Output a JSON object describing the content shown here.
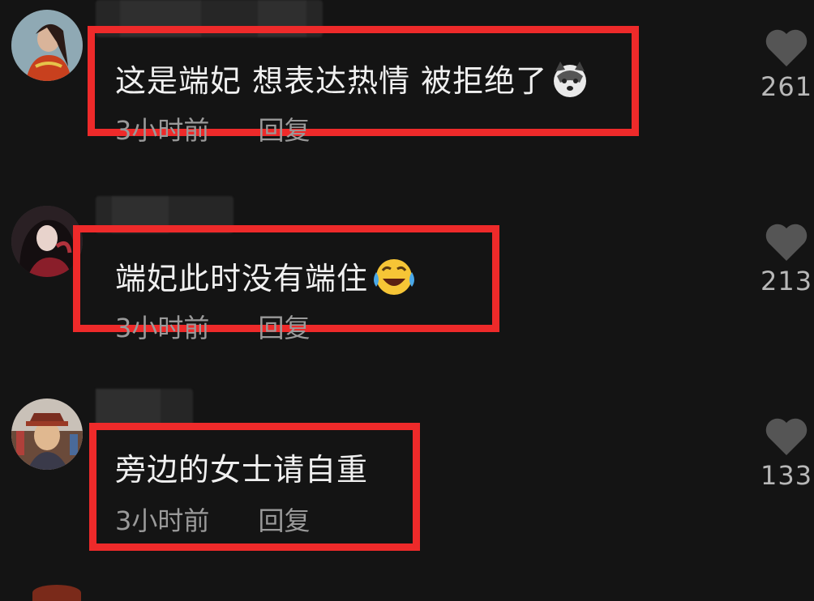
{
  "comments": [
    {
      "text": "这是端妃 想表达热情 被拒绝了",
      "emoji": "husky-dog-emoji",
      "time": "3小时前",
      "reply": "回复",
      "likes": "261",
      "highlight_color": "#ee2a2a"
    },
    {
      "text": "端妃此时没有端住",
      "emoji": "laughing-crying-emoji",
      "time": "3小时前",
      "reply": "回复",
      "likes": "213",
      "highlight_color": "#ee2a2a"
    },
    {
      "text": "旁边的女士请自重",
      "emoji": "",
      "time": "3小时前",
      "reply": "回复",
      "likes": "133",
      "highlight_color": "#ee2a2a"
    }
  ],
  "icons": {
    "like": "heart-icon"
  },
  "colors": {
    "background": "#141414",
    "highlight": "#ee2a2a",
    "meta_text": "#9a9a9a"
  }
}
